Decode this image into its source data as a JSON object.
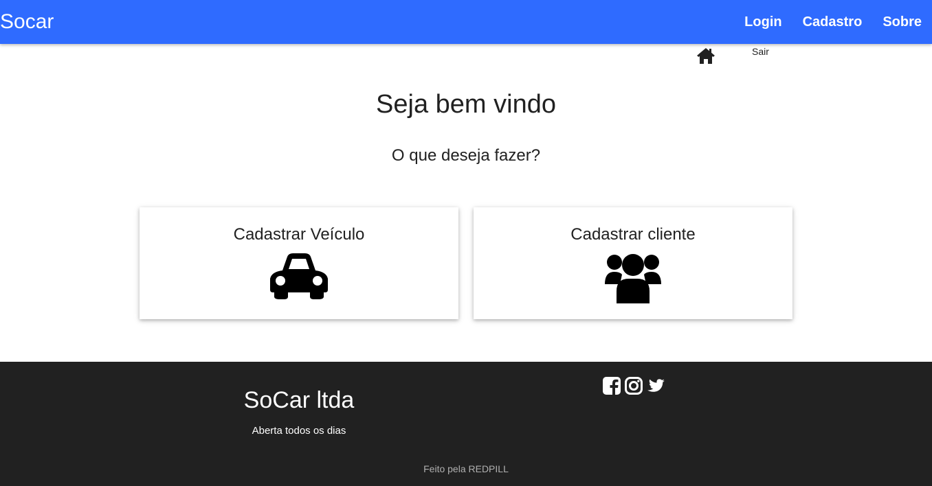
{
  "navbar": {
    "brand": "Socar",
    "links": [
      "Login",
      "Cadastro",
      "Sobre"
    ],
    "color": "#2f6bff"
  },
  "subnav": {
    "home_icon": "home-icon",
    "logout_label": "Sair"
  },
  "main": {
    "title": "Seja bem vindo",
    "question": "O que deseja fazer?",
    "cards": [
      {
        "label": "Cadastrar Veículo",
        "icon": "car-icon"
      },
      {
        "label": "Cadastrar cliente",
        "icon": "users-icon"
      }
    ]
  },
  "footer": {
    "title": "SoCar ltda",
    "subtitle": "Aberta todos os dias",
    "social_icons": [
      "facebook-icon",
      "instagram-icon",
      "twitter-icon"
    ],
    "credit": "Feito pela REDPILL",
    "background": "#212121"
  }
}
